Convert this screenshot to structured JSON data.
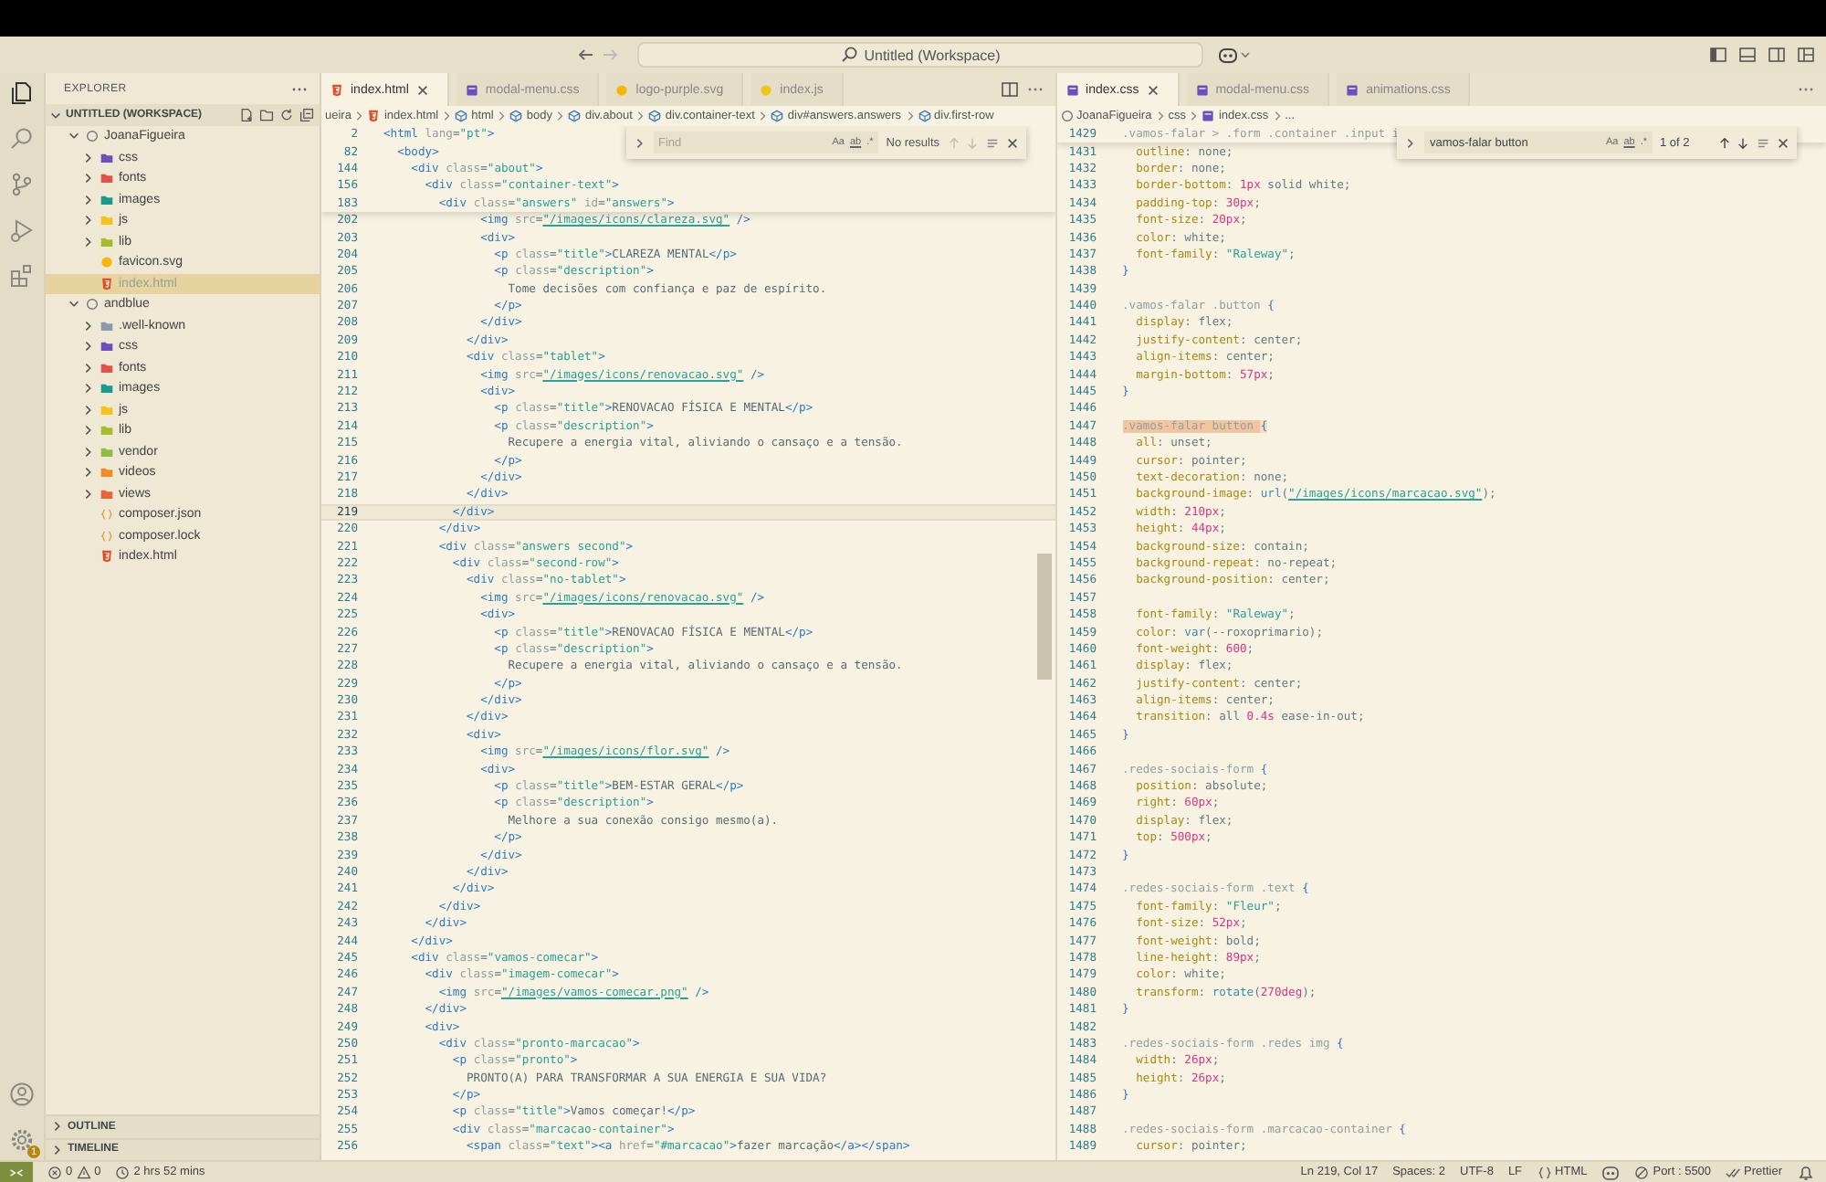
{
  "title_bar": {
    "search": "Untitled (Workspace)"
  },
  "sidebar": {
    "title": "EXPLORER",
    "section": {
      "label": "UNTITLED (WORKSPACE)",
      "expanded": true
    },
    "tree": [
      {
        "label": "JoanaFigueira",
        "kind": "root",
        "expanded": true,
        "selected": false,
        "children": [
          {
            "label": "css",
            "kind": "folder",
            "expanded": false,
            "selected": false,
            "color": "#6b4fbb"
          },
          {
            "label": "fonts",
            "kind": "folder",
            "expanded": false,
            "selected": false,
            "color": "#e2504c"
          },
          {
            "label": "images",
            "kind": "folder",
            "expanded": false,
            "selected": false,
            "color": "#1a9a8c"
          },
          {
            "label": "js",
            "kind": "folder",
            "expanded": false,
            "selected": false,
            "color": "#f3c316"
          },
          {
            "label": "lib",
            "kind": "folder",
            "expanded": false,
            "selected": false,
            "color": "#a4bd2d"
          },
          {
            "label": "favicon.svg",
            "kind": "svg-file",
            "selected": false
          },
          {
            "label": "index.html",
            "kind": "html-file",
            "selected": true
          }
        ]
      },
      {
        "label": "andblue",
        "kind": "root",
        "expanded": true,
        "selected": false,
        "children": [
          {
            "label": ".well-known",
            "kind": "folder",
            "expanded": false,
            "selected": false,
            "color": "#8a9aa8"
          },
          {
            "label": "css",
            "kind": "folder",
            "expanded": false,
            "selected": false,
            "color": "#6b4fbb"
          },
          {
            "label": "fonts",
            "kind": "folder",
            "expanded": false,
            "selected": false,
            "color": "#e2504c"
          },
          {
            "label": "images",
            "kind": "folder",
            "expanded": false,
            "selected": false,
            "color": "#1a9a8c"
          },
          {
            "label": "js",
            "kind": "folder",
            "expanded": false,
            "selected": false,
            "color": "#f3c316"
          },
          {
            "label": "lib",
            "kind": "folder",
            "expanded": false,
            "selected": false,
            "color": "#a4bd2d"
          },
          {
            "label": "vendor",
            "kind": "folder",
            "expanded": false,
            "selected": false,
            "color": "#8cbf3f"
          },
          {
            "label": "videos",
            "kind": "folder",
            "expanded": false,
            "selected": false,
            "color": "#f08a24"
          },
          {
            "label": "views",
            "kind": "folder",
            "expanded": false,
            "selected": false,
            "color": "#e8643c"
          },
          {
            "label": "composer.json",
            "kind": "json-file",
            "selected": false
          },
          {
            "label": "composer.lock",
            "kind": "json-file",
            "selected": false
          },
          {
            "label": "index.html",
            "kind": "html-file",
            "selected": false
          }
        ]
      }
    ],
    "panels": [
      {
        "label": "OUTLINE",
        "expanded": false
      },
      {
        "label": "TIMELINE",
        "expanded": false
      }
    ],
    "settings_badge": "1"
  },
  "editors": [
    {
      "kind": "html",
      "tabs": [
        {
          "label": "index.html",
          "kind": "html",
          "selected": true
        },
        {
          "label": "modal-menu.css",
          "kind": "css",
          "selected": false
        },
        {
          "label": "logo-purple.svg",
          "kind": "svg",
          "selected": false
        },
        {
          "label": "index.js",
          "kind": "js",
          "selected": false
        }
      ],
      "breadcrumbs": [
        {
          "label": "ueira",
          "kind": "folder"
        },
        {
          "label": "index.html",
          "kind": "html"
        },
        {
          "label": "html",
          "kind": "element"
        },
        {
          "label": "body",
          "kind": "element"
        },
        {
          "label": "div.about",
          "kind": "element"
        },
        {
          "label": "div.container-text",
          "kind": "element"
        },
        {
          "label": "div#answers.answers",
          "kind": "element"
        },
        {
          "label": "div.first-row",
          "kind": "element"
        }
      ],
      "find": {
        "placeholder": "Find",
        "options": [
          "Aa",
          "ab",
          ".*"
        ],
        "result": "No results",
        "nav_disabled": true
      },
      "sticky": [
        {
          "n": "2",
          "code": "<html lang=\"pt\">"
        },
        {
          "n": "82",
          "code": "  <body>"
        },
        {
          "n": "144",
          "code": "    <div class=\"about\">"
        },
        {
          "n": "156",
          "code": "      <div class=\"container-text\">"
        },
        {
          "n": "183",
          "code": "        <div class=\"answers\" id=\"answers\">"
        }
      ],
      "lines": [
        {
          "n": "202",
          "code": "              <img src=\"/images/icons/clareza.svg\" />",
          "current": false
        },
        {
          "n": "203",
          "code": "              <div>",
          "current": false
        },
        {
          "n": "204",
          "code": "                <p class=\"title\">CLAREZA MENTAL</p>",
          "current": false
        },
        {
          "n": "205",
          "code": "                <p class=\"description\">",
          "current": false
        },
        {
          "n": "206",
          "code": "                  Tome decisões com confiança e paz de espírito.",
          "current": false
        },
        {
          "n": "207",
          "code": "                </p>",
          "current": false
        },
        {
          "n": "208",
          "code": "              </div>",
          "current": false
        },
        {
          "n": "209",
          "code": "            </div>",
          "current": false
        },
        {
          "n": "210",
          "code": "            <div class=\"tablet\">",
          "current": false
        },
        {
          "n": "211",
          "code": "              <img src=\"/images/icons/renovacao.svg\" />",
          "current": false
        },
        {
          "n": "212",
          "code": "              <div>",
          "current": false
        },
        {
          "n": "213",
          "code": "                <p class=\"title\">RENOVACAO FÍSICA E MENTAL</p>",
          "current": false
        },
        {
          "n": "214",
          "code": "                <p class=\"description\">",
          "current": false
        },
        {
          "n": "215",
          "code": "                  Recupere a energia vital, aliviando o cansaço e a tensão.",
          "current": false
        },
        {
          "n": "216",
          "code": "                </p>",
          "current": false
        },
        {
          "n": "217",
          "code": "              </div>",
          "current": false
        },
        {
          "n": "218",
          "code": "            </div>",
          "current": false
        },
        {
          "n": "219",
          "code": "          </div>",
          "current": true
        },
        {
          "n": "220",
          "code": "        </div>",
          "current": false
        },
        {
          "n": "221",
          "code": "        <div class=\"answers second\">",
          "current": false
        },
        {
          "n": "222",
          "code": "          <div class=\"second-row\">",
          "current": false
        },
        {
          "n": "223",
          "code": "            <div class=\"no-tablet\">",
          "current": false
        },
        {
          "n": "224",
          "code": "              <img src=\"/images/icons/renovacao.svg\" />",
          "current": false
        },
        {
          "n": "225",
          "code": "              <div>",
          "current": false
        },
        {
          "n": "226",
          "code": "                <p class=\"title\">RENOVACAO FÍSICA E MENTAL</p>",
          "current": false
        },
        {
          "n": "227",
          "code": "                <p class=\"description\">",
          "current": false
        },
        {
          "n": "228",
          "code": "                  Recupere a energia vital, aliviando o cansaço e a tensão.",
          "current": false
        },
        {
          "n": "229",
          "code": "                </p>",
          "current": false
        },
        {
          "n": "230",
          "code": "              </div>",
          "current": false
        },
        {
          "n": "231",
          "code": "            </div>",
          "current": false
        },
        {
          "n": "232",
          "code": "            <div>",
          "current": false
        },
        {
          "n": "233",
          "code": "              <img src=\"/images/icons/flor.svg\" />",
          "current": false
        },
        {
          "n": "234",
          "code": "              <div>",
          "current": false
        },
        {
          "n": "235",
          "code": "                <p class=\"title\">BEM-ESTAR GERAL</p>",
          "current": false
        },
        {
          "n": "236",
          "code": "                <p class=\"description\">",
          "current": false
        },
        {
          "n": "237",
          "code": "                  Melhore a sua conexão consigo mesmo(a).",
          "current": false
        },
        {
          "n": "238",
          "code": "                </p>",
          "current": false
        },
        {
          "n": "239",
          "code": "              </div>",
          "current": false
        },
        {
          "n": "240",
          "code": "            </div>",
          "current": false
        },
        {
          "n": "241",
          "code": "          </div>",
          "current": false
        },
        {
          "n": "242",
          "code": "        </div>",
          "current": false
        },
        {
          "n": "243",
          "code": "      </div>",
          "current": false
        },
        {
          "n": "244",
          "code": "    </div>",
          "current": false
        },
        {
          "n": "245",
          "code": "    <div class=\"vamos-comecar\">",
          "current": false
        },
        {
          "n": "246",
          "code": "      <div class=\"imagem-comecar\">",
          "current": false
        },
        {
          "n": "247",
          "code": "        <img src=\"/images/vamos-comecar.png\" />",
          "current": false
        },
        {
          "n": "248",
          "code": "      </div>",
          "current": false
        },
        {
          "n": "249",
          "code": "      <div>",
          "current": false
        },
        {
          "n": "250",
          "code": "        <div class=\"pronto-marcacao\">",
          "current": false
        },
        {
          "n": "251",
          "code": "          <p class=\"pronto\">",
          "current": false
        },
        {
          "n": "252",
          "code": "            PRONTO(A) PARA TRANSFORMAR A SUA ENERGIA E SUA VIDA?",
          "current": false
        },
        {
          "n": "253",
          "code": "          </p>",
          "current": false
        },
        {
          "n": "254",
          "code": "          <p class=\"title\">Vamos começar!</p>",
          "current": false
        },
        {
          "n": "255",
          "code": "          <div class=\"marcacao-container\">",
          "current": false
        },
        {
          "n": "256",
          "code": "            <span class=\"text\"><a href=\"#marcacao\">fazer marcação</a></span>",
          "current": false
        }
      ]
    },
    {
      "kind": "css",
      "tabs": [
        {
          "label": "index.css",
          "kind": "css",
          "selected": true
        },
        {
          "label": "modal-menu.css",
          "kind": "css",
          "selected": false
        },
        {
          "label": "animations.css",
          "kind": "css",
          "selected": false
        }
      ],
      "breadcrumbs": [
        {
          "label": "JoanaFigueira",
          "kind": "root"
        },
        {
          "label": "css",
          "kind": "folder"
        },
        {
          "label": "index.css",
          "kind": "css"
        },
        {
          "label": "...",
          "kind": "more"
        }
      ],
      "find": {
        "value": "vamos-falar button",
        "options": [
          "Aa",
          "ab",
          ".*"
        ],
        "result": "1 of 2",
        "nav_disabled": false
      },
      "sticky": [
        {
          "n": "1429",
          "code": ".vamos-falar > .form .container .input i"
        }
      ],
      "lines": [
        {
          "n": "1431",
          "code": "  outline: none;",
          "match": false
        },
        {
          "n": "1432",
          "code": "  border: none;",
          "match": false
        },
        {
          "n": "1433",
          "code": "  border-bottom: 1px solid white;",
          "match": false
        },
        {
          "n": "1434",
          "code": "  padding-top: 30px;",
          "match": false
        },
        {
          "n": "1435",
          "code": "  font-size: 20px;",
          "match": false
        },
        {
          "n": "1436",
          "code": "  color: white;",
          "match": false
        },
        {
          "n": "1437",
          "code": "  font-family: \"Raleway\";",
          "match": false
        },
        {
          "n": "1438",
          "code": "}",
          "match": false
        },
        {
          "n": "1439",
          "match": false
        },
        {
          "n": "1440",
          "code": ".vamos-falar .button {",
          "match": false
        },
        {
          "n": "1441",
          "code": "  display: flex;",
          "match": false
        },
        {
          "n": "1442",
          "code": "  justify-content: center;",
          "match": false
        },
        {
          "n": "1443",
          "code": "  align-items: center;",
          "match": false
        },
        {
          "n": "1444",
          "code": "  margin-bottom: 57px;",
          "match": false
        },
        {
          "n": "1445",
          "code": "}",
          "match": false
        },
        {
          "n": "1446",
          "match": false
        },
        {
          "n": "1447",
          "code": ".vamos-falar button {",
          "match": true
        },
        {
          "n": "1448",
          "code": "  all: unset;",
          "match": false
        },
        {
          "n": "1449",
          "code": "  cursor: pointer;",
          "match": false
        },
        {
          "n": "1450",
          "code": "  text-decoration: none;",
          "match": false
        },
        {
          "n": "1451",
          "code": "  background-image: url(\"/images/icons/marcacao.svg\");",
          "match": false
        },
        {
          "n": "1452",
          "code": "  width: 210px;",
          "match": false
        },
        {
          "n": "1453",
          "code": "  height: 44px;",
          "match": false
        },
        {
          "n": "1454",
          "code": "  background-size: contain;",
          "match": false
        },
        {
          "n": "1455",
          "code": "  background-repeat: no-repeat;",
          "match": false
        },
        {
          "n": "1456",
          "code": "  background-position: center;",
          "match": false
        },
        {
          "n": "1457",
          "match": false
        },
        {
          "n": "1458",
          "code": "  font-family: \"Raleway\";",
          "match": false
        },
        {
          "n": "1459",
          "code": "  color: var(--roxoprimario);",
          "match": false
        },
        {
          "n": "1460",
          "code": "  font-weight: 600;",
          "match": false
        },
        {
          "n": "1461",
          "code": "  display: flex;",
          "match": false
        },
        {
          "n": "1462",
          "code": "  justify-content: center;",
          "match": false
        },
        {
          "n": "1463",
          "code": "  align-items: center;",
          "match": false
        },
        {
          "n": "1464",
          "code": "  transition: all 0.4s ease-in-out;",
          "match": false
        },
        {
          "n": "1465",
          "code": "}",
          "match": false
        },
        {
          "n": "1466",
          "match": false
        },
        {
          "n": "1467",
          "code": ".redes-sociais-form {",
          "match": false
        },
        {
          "n": "1468",
          "code": "  position: absolute;",
          "match": false
        },
        {
          "n": "1469",
          "code": "  right: 60px;",
          "match": false
        },
        {
          "n": "1470",
          "code": "  display: flex;",
          "match": false
        },
        {
          "n": "1471",
          "code": "  top: 500px;",
          "match": false
        },
        {
          "n": "1472",
          "code": "}",
          "match": false
        },
        {
          "n": "1473",
          "match": false
        },
        {
          "n": "1474",
          "code": ".redes-sociais-form .text {",
          "match": false
        },
        {
          "n": "1475",
          "code": "  font-family: \"Fleur\";",
          "match": false
        },
        {
          "n": "1476",
          "code": "  font-size: 52px;",
          "match": false
        },
        {
          "n": "1477",
          "code": "  font-weight: bold;",
          "match": false
        },
        {
          "n": "1478",
          "code": "  line-height: 89px;",
          "match": false
        },
        {
          "n": "1479",
          "code": "  color: white;",
          "match": false
        },
        {
          "n": "1480",
          "code": "  transform: rotate(270deg);",
          "match": false
        },
        {
          "n": "1481",
          "code": "}",
          "match": false
        },
        {
          "n": "1482",
          "match": false
        },
        {
          "n": "1483",
          "code": ".redes-sociais-form .redes img {",
          "match": false
        },
        {
          "n": "1484",
          "code": "  width: 26px;",
          "match": false
        },
        {
          "n": "1485",
          "code": "  height: 26px;",
          "match": false
        },
        {
          "n": "1486",
          "code": "}",
          "match": false
        },
        {
          "n": "1487",
          "match": false
        },
        {
          "n": "1488",
          "code": ".redes-sociais-form .marcacao-container {",
          "match": false
        },
        {
          "n": "1489",
          "code": "  cursor: pointer;",
          "match": false
        }
      ]
    }
  ],
  "status_bar": {
    "errors": "0",
    "warnings": "0",
    "timer": "2 hrs 52 mins",
    "position": "Ln 219, Col 17",
    "indent": "Spaces: 2",
    "encoding": "UTF-8",
    "eol": "LF",
    "language": "HTML",
    "port": "Port : 5500",
    "formatter": "Prettier"
  }
}
